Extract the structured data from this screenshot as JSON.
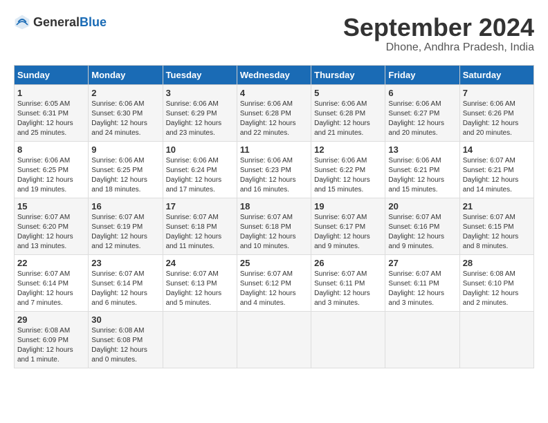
{
  "header": {
    "logo_general": "General",
    "logo_blue": "Blue",
    "month_year": "September 2024",
    "location": "Dhone, Andhra Pradesh, India"
  },
  "days_of_week": [
    "Sunday",
    "Monday",
    "Tuesday",
    "Wednesday",
    "Thursday",
    "Friday",
    "Saturday"
  ],
  "weeks": [
    [
      {
        "day": "1",
        "sunrise": "6:05 AM",
        "sunset": "6:31 PM",
        "daylight": "12 hours and 25 minutes."
      },
      {
        "day": "2",
        "sunrise": "6:06 AM",
        "sunset": "6:30 PM",
        "daylight": "12 hours and 24 minutes."
      },
      {
        "day": "3",
        "sunrise": "6:06 AM",
        "sunset": "6:29 PM",
        "daylight": "12 hours and 23 minutes."
      },
      {
        "day": "4",
        "sunrise": "6:06 AM",
        "sunset": "6:28 PM",
        "daylight": "12 hours and 22 minutes."
      },
      {
        "day": "5",
        "sunrise": "6:06 AM",
        "sunset": "6:28 PM",
        "daylight": "12 hours and 21 minutes."
      },
      {
        "day": "6",
        "sunrise": "6:06 AM",
        "sunset": "6:27 PM",
        "daylight": "12 hours and 20 minutes."
      },
      {
        "day": "7",
        "sunrise": "6:06 AM",
        "sunset": "6:26 PM",
        "daylight": "12 hours and 20 minutes."
      }
    ],
    [
      {
        "day": "8",
        "sunrise": "6:06 AM",
        "sunset": "6:25 PM",
        "daylight": "12 hours and 19 minutes."
      },
      {
        "day": "9",
        "sunrise": "6:06 AM",
        "sunset": "6:25 PM",
        "daylight": "12 hours and 18 minutes."
      },
      {
        "day": "10",
        "sunrise": "6:06 AM",
        "sunset": "6:24 PM",
        "daylight": "12 hours and 17 minutes."
      },
      {
        "day": "11",
        "sunrise": "6:06 AM",
        "sunset": "6:23 PM",
        "daylight": "12 hours and 16 minutes."
      },
      {
        "day": "12",
        "sunrise": "6:06 AM",
        "sunset": "6:22 PM",
        "daylight": "12 hours and 15 minutes."
      },
      {
        "day": "13",
        "sunrise": "6:06 AM",
        "sunset": "6:21 PM",
        "daylight": "12 hours and 15 minutes."
      },
      {
        "day": "14",
        "sunrise": "6:07 AM",
        "sunset": "6:21 PM",
        "daylight": "12 hours and 14 minutes."
      }
    ],
    [
      {
        "day": "15",
        "sunrise": "6:07 AM",
        "sunset": "6:20 PM",
        "daylight": "12 hours and 13 minutes."
      },
      {
        "day": "16",
        "sunrise": "6:07 AM",
        "sunset": "6:19 PM",
        "daylight": "12 hours and 12 minutes."
      },
      {
        "day": "17",
        "sunrise": "6:07 AM",
        "sunset": "6:18 PM",
        "daylight": "12 hours and 11 minutes."
      },
      {
        "day": "18",
        "sunrise": "6:07 AM",
        "sunset": "6:18 PM",
        "daylight": "12 hours and 10 minutes."
      },
      {
        "day": "19",
        "sunrise": "6:07 AM",
        "sunset": "6:17 PM",
        "daylight": "12 hours and 9 minutes."
      },
      {
        "day": "20",
        "sunrise": "6:07 AM",
        "sunset": "6:16 PM",
        "daylight": "12 hours and 9 minutes."
      },
      {
        "day": "21",
        "sunrise": "6:07 AM",
        "sunset": "6:15 PM",
        "daylight": "12 hours and 8 minutes."
      }
    ],
    [
      {
        "day": "22",
        "sunrise": "6:07 AM",
        "sunset": "6:14 PM",
        "daylight": "12 hours and 7 minutes."
      },
      {
        "day": "23",
        "sunrise": "6:07 AM",
        "sunset": "6:14 PM",
        "daylight": "12 hours and 6 minutes."
      },
      {
        "day": "24",
        "sunrise": "6:07 AM",
        "sunset": "6:13 PM",
        "daylight": "12 hours and 5 minutes."
      },
      {
        "day": "25",
        "sunrise": "6:07 AM",
        "sunset": "6:12 PM",
        "daylight": "12 hours and 4 minutes."
      },
      {
        "day": "26",
        "sunrise": "6:07 AM",
        "sunset": "6:11 PM",
        "daylight": "12 hours and 3 minutes."
      },
      {
        "day": "27",
        "sunrise": "6:07 AM",
        "sunset": "6:11 PM",
        "daylight": "12 hours and 3 minutes."
      },
      {
        "day": "28",
        "sunrise": "6:08 AM",
        "sunset": "6:10 PM",
        "daylight": "12 hours and 2 minutes."
      }
    ],
    [
      {
        "day": "29",
        "sunrise": "6:08 AM",
        "sunset": "6:09 PM",
        "daylight": "12 hours and 1 minute."
      },
      {
        "day": "30",
        "sunrise": "6:08 AM",
        "sunset": "6:08 PM",
        "daylight": "12 hours and 0 minutes."
      },
      null,
      null,
      null,
      null,
      null
    ]
  ],
  "labels": {
    "sunrise": "Sunrise:",
    "sunset": "Sunset:",
    "daylight": "Daylight:"
  }
}
